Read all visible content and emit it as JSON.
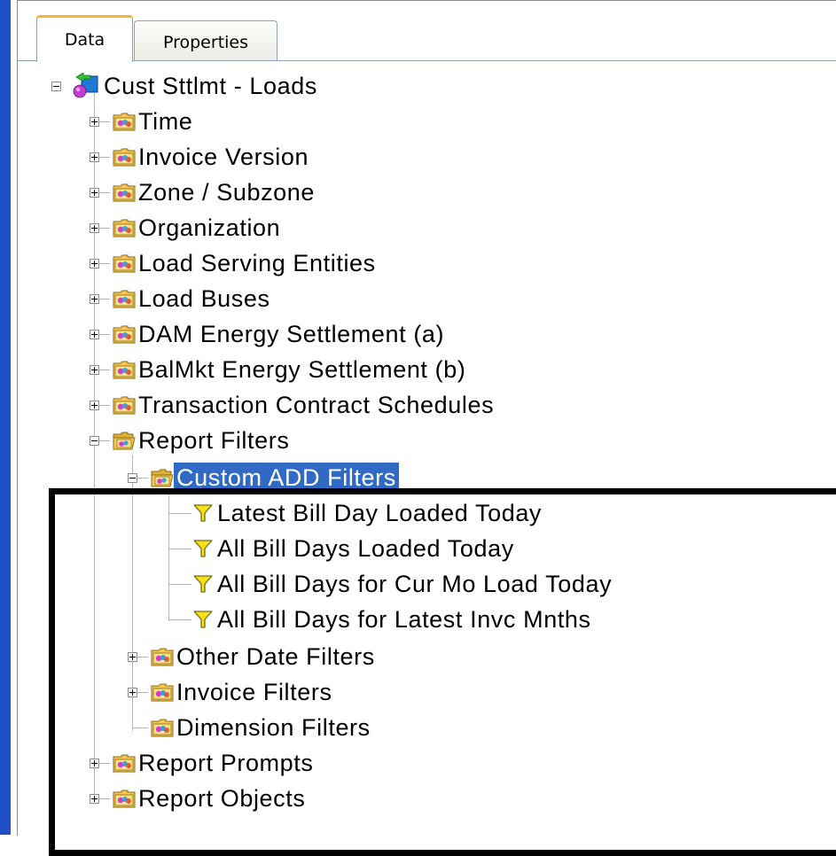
{
  "tabs": [
    {
      "label": "Data",
      "active": true
    },
    {
      "label": "Properties",
      "active": false
    }
  ],
  "tree": {
    "root": {
      "label": "Cust Sttlmt - Loads",
      "icon": "universe-icon",
      "expanded": true
    },
    "items": [
      {
        "label": "Time",
        "icon": "class-folder-icon",
        "expanded": false
      },
      {
        "label": "Invoice Version",
        "icon": "class-folder-icon",
        "expanded": false
      },
      {
        "label": "Zone / Subzone",
        "icon": "class-folder-icon",
        "expanded": false
      },
      {
        "label": "Organization",
        "icon": "class-folder-icon",
        "expanded": false
      },
      {
        "label": "Load Serving Entities",
        "icon": "class-folder-icon",
        "expanded": false
      },
      {
        "label": "Load Buses",
        "icon": "class-folder-icon",
        "expanded": false
      },
      {
        "label": "DAM Energy Settlement (a)",
        "icon": "class-folder-icon",
        "expanded": false
      },
      {
        "label": "BalMkt Energy Settlement (b)",
        "icon": "class-folder-icon",
        "expanded": false
      },
      {
        "label": "Transaction Contract Schedules",
        "icon": "class-folder-icon",
        "expanded": false
      },
      {
        "label": "Report Filters",
        "icon": "open-class-folder-icon",
        "expanded": true,
        "children": [
          {
            "label": "Custom ADD Filters",
            "icon": "open-class-folder-icon",
            "expanded": true,
            "selected": true,
            "children": [
              {
                "label": "Latest Bill Day Loaded Today",
                "icon": "filter-icon"
              },
              {
                "label": "All Bill Days Loaded Today",
                "icon": "filter-icon"
              },
              {
                "label": "All Bill Days for Cur Mo Load Today",
                "icon": "filter-icon"
              },
              {
                "label": "All Bill Days for Latest Invc Mnths",
                "icon": "filter-icon"
              }
            ]
          },
          {
            "label": "Other Date Filters",
            "icon": "class-folder-icon",
            "expanded": false
          },
          {
            "label": "Invoice Filters",
            "icon": "class-folder-icon",
            "expanded": false
          },
          {
            "label": "Dimension Filters",
            "icon": "class-folder-icon"
          }
        ]
      },
      {
        "label": "Report Prompts",
        "icon": "class-folder-icon",
        "expanded": false
      },
      {
        "label": "Report Objects",
        "icon": "class-folder-icon",
        "expanded": false
      }
    ]
  },
  "colors": {
    "selection": "#316ac5",
    "left_bar": "#1f4fc6",
    "active_tab_accent": "#f7b23f",
    "tree_lines": "#b5b5b5"
  }
}
